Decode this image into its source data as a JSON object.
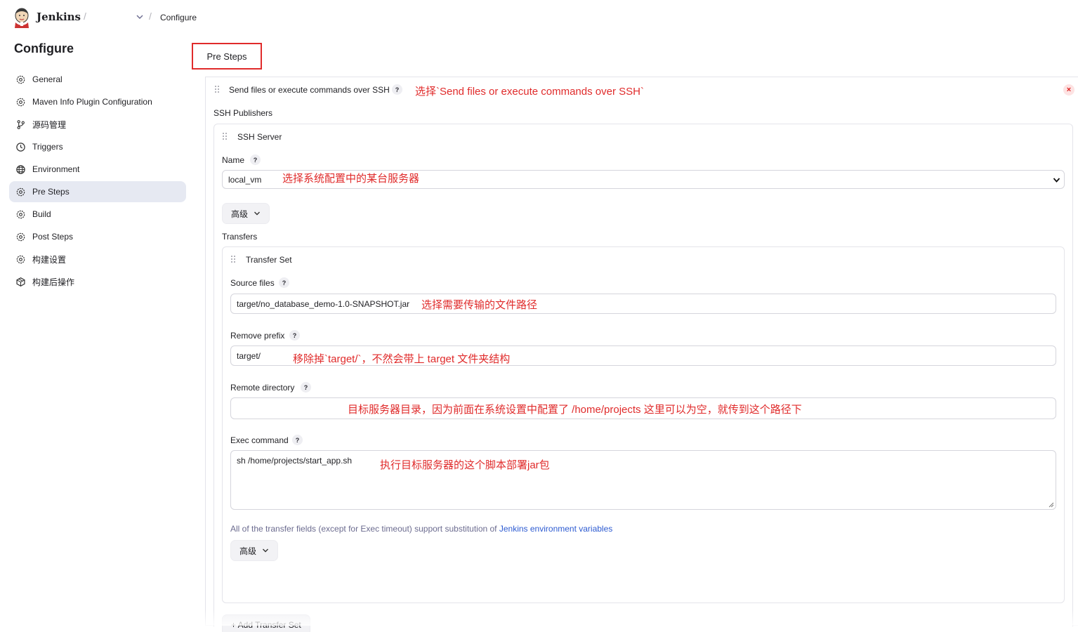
{
  "header": {
    "brand": "Jenkins",
    "separator": "/",
    "current_page": "Configure"
  },
  "sidebar": {
    "title": "Configure",
    "items": [
      {
        "label": "General",
        "icon": "gear-icon"
      },
      {
        "label": "Maven Info Plugin Configuration",
        "icon": "gear-icon"
      },
      {
        "label": "源码管理",
        "icon": "branch-icon"
      },
      {
        "label": "Triggers",
        "icon": "clock-icon"
      },
      {
        "label": "Environment",
        "icon": "globe-icon"
      },
      {
        "label": "Pre Steps",
        "icon": "gear-icon",
        "active": true
      },
      {
        "label": "Build",
        "icon": "gear-icon"
      },
      {
        "label": "Post Steps",
        "icon": "gear-icon"
      },
      {
        "label": "构建设置",
        "icon": "gear-icon"
      },
      {
        "label": "构建后操作",
        "icon": "package-icon"
      }
    ]
  },
  "section_title": "Pre Steps",
  "step": {
    "title": "Send files or execute commands over SSH",
    "help": "?",
    "close": "×",
    "note": "选择`Send files or execute commands over SSH`",
    "publishers_label": "SSH Publishers",
    "server": {
      "title": "SSH Server",
      "name_label": "Name",
      "name_value": "local_vm",
      "name_note": "选择系统配置中的某台服务器",
      "advanced_label": "高级",
      "transfers_label": "Transfers",
      "transfer_set": {
        "title": "Transfer Set",
        "source_files_label": "Source files",
        "source_files_value": "target/no_database_demo-1.0-SNAPSHOT.jar",
        "source_files_note": "选择需要传输的文件路径",
        "remove_prefix_label": "Remove prefix",
        "remove_prefix_value": "target/",
        "remove_prefix_note": "移除掉`target/`，不然会带上 target 文件夹结构",
        "remote_directory_label": "Remote directory",
        "remote_directory_value": "",
        "remote_directory_note": "目标服务器目录，因为前面在系统设置中配置了 /home/projects 这里可以为空，就传到这个路径下",
        "exec_command_label": "Exec command",
        "exec_command_value": "sh /home/projects/start_app.sh",
        "exec_command_note": "执行目标服务器的这个脚本部署jar包",
        "help_text": "All of the transfer fields (except for Exec timeout) support substitution of ",
        "help_link": "Jenkins environment variables",
        "advanced_label": "高级"
      },
      "add_transfer_label": "+ Add Transfer Set"
    }
  },
  "colors": {
    "annotation_red": "#e02b2b",
    "active_nav_bg": "#e6e9f2",
    "link_blue": "#2c5ad1"
  }
}
